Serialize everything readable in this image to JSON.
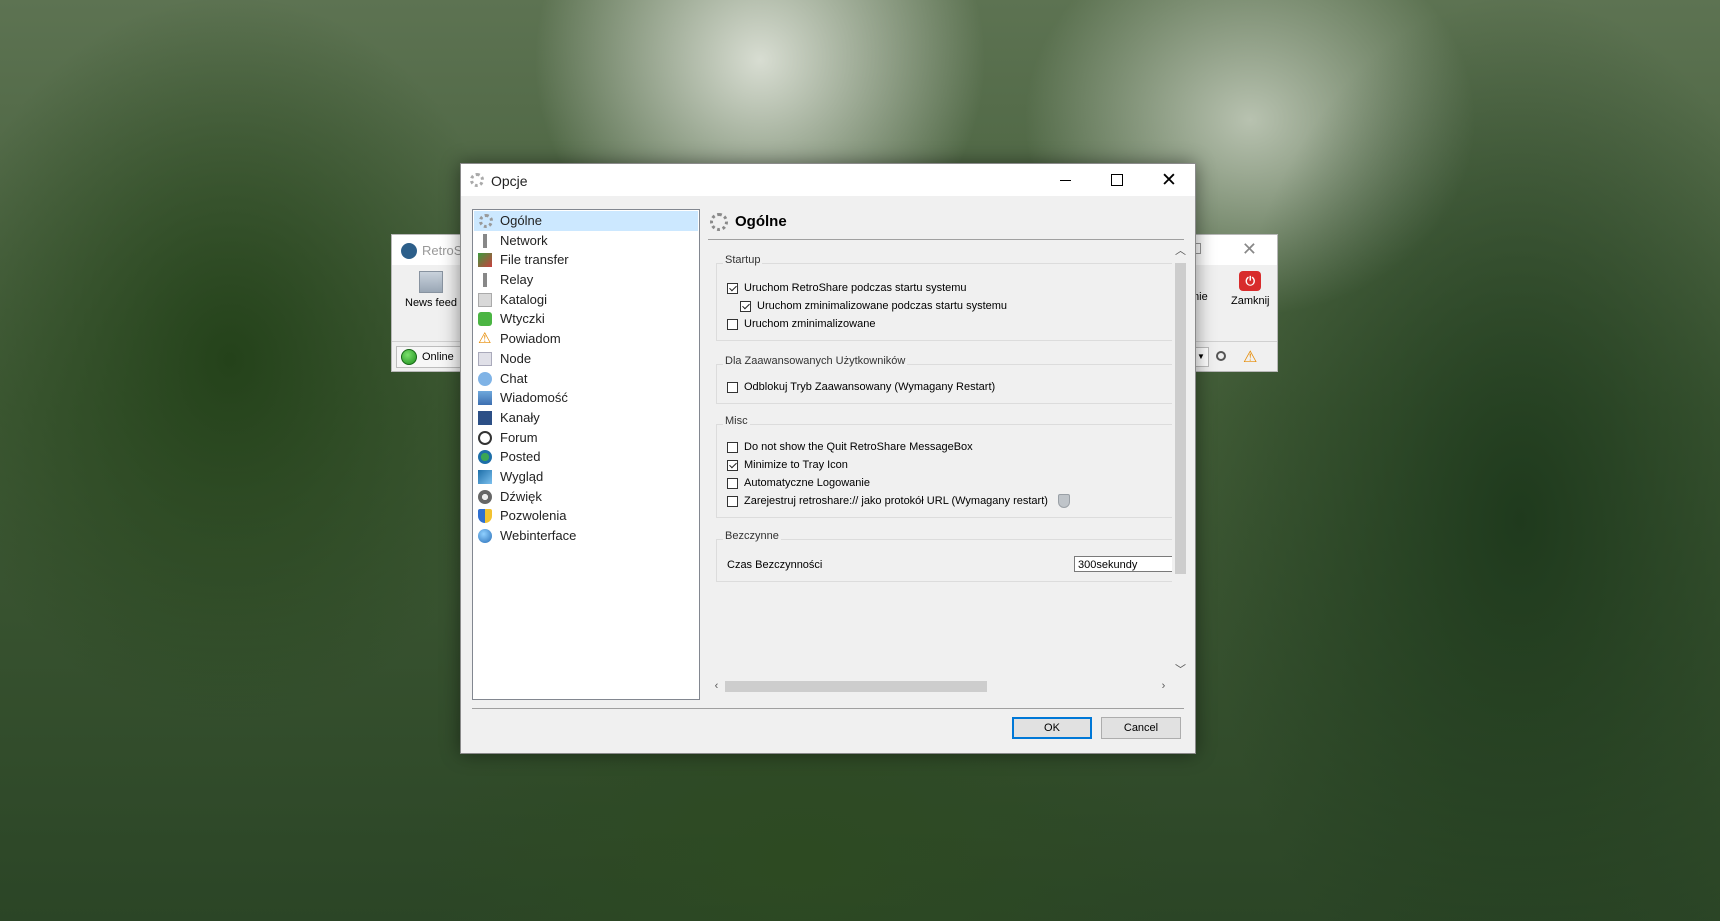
{
  "main_window": {
    "title": "RetroS",
    "toolbar": {
      "news_feed": "News feed",
      "partial_label": "mie",
      "quit": "Zamknij"
    },
    "status": {
      "online": "Online"
    }
  },
  "dialog": {
    "title": "Opcje",
    "nav_items": [
      {
        "label": "Ogólne",
        "icon": "gear-icon"
      },
      {
        "label": "Network",
        "icon": "network-icon"
      },
      {
        "label": "File transfer",
        "icon": "file-transfer-icon"
      },
      {
        "label": "Relay",
        "icon": "relay-icon"
      },
      {
        "label": "Katalogi",
        "icon": "folders-icon"
      },
      {
        "label": "Wtyczki",
        "icon": "puzzle-icon"
      },
      {
        "label": "Powiadom",
        "icon": "warning-icon"
      },
      {
        "label": "Node",
        "icon": "node-icon"
      },
      {
        "label": "Chat",
        "icon": "chat-icon"
      },
      {
        "label": "Wiadomość",
        "icon": "message-icon"
      },
      {
        "label": "Kanały",
        "icon": "channels-icon"
      },
      {
        "label": "Forum",
        "icon": "forum-icon"
      },
      {
        "label": "Posted",
        "icon": "posted-icon"
      },
      {
        "label": "Wygląd",
        "icon": "appearance-icon"
      },
      {
        "label": "Dźwięk",
        "icon": "sound-icon"
      },
      {
        "label": "Pozwolenia",
        "icon": "permissions-icon"
      },
      {
        "label": "Webinterface",
        "icon": "globe-icon"
      }
    ],
    "header": "Ogólne",
    "startup": {
      "title": "Startup",
      "start_on_boot": "Uruchom RetroShare podczas startu systemu",
      "start_minimized_on_boot": "Uruchom zminimalizowane podczas startu systemu",
      "start_minimized": "Uruchom zminimalizowane"
    },
    "advanced": {
      "title": "Dla Zaawansowanych Użytkowników",
      "unlock_advanced": "Odblokuj Tryb Zaawansowany (Wymagany Restart)"
    },
    "misc": {
      "title": "Misc",
      "no_quit_box": "Do not show the Quit RetroShare MessageBox",
      "tray": "Minimize to Tray Icon",
      "auto_login": "Automatyczne Logowanie",
      "register_url": "Zarejestruj retroshare:// jako protokół URL (Wymagany restart)"
    },
    "idle": {
      "title": "Bezczynne",
      "label": "Czas Bezczynności",
      "value": "300sekundy"
    },
    "buttons": {
      "ok": "OK",
      "cancel": "Cancel"
    }
  }
}
